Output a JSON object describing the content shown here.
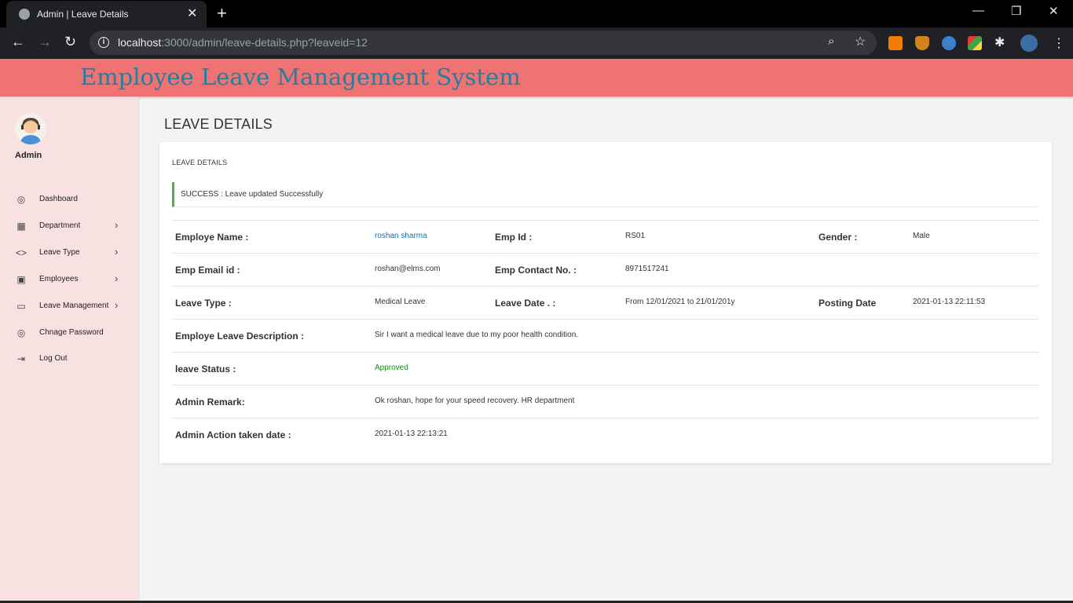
{
  "browser": {
    "tab_title": "Admin | Leave Details",
    "url_host": "localhost",
    "url_rest": ":3000/admin/leave-details.php?leaveid=12"
  },
  "app": {
    "brand": "Employee Leave Management System"
  },
  "sidebar": {
    "user": "Admin",
    "items": [
      {
        "label": "Dashboard",
        "icon": "palette-icon",
        "has_submenu": false
      },
      {
        "label": "Department",
        "icon": "grid-icon",
        "has_submenu": true
      },
      {
        "label": "Leave Type",
        "icon": "code-icon",
        "has_submenu": true
      },
      {
        "label": "Employees",
        "icon": "account-box-icon",
        "has_submenu": true
      },
      {
        "label": "Leave Management",
        "icon": "desktop-icon",
        "has_submenu": true
      },
      {
        "label": "Chnage Password",
        "icon": "palette-icon",
        "has_submenu": false
      },
      {
        "label": "Log Out",
        "icon": "logout-icon",
        "has_submenu": false
      }
    ]
  },
  "main": {
    "page_title": "LEAVE DETAILS",
    "card_title": "LEAVE DETAILS",
    "alert": "SUCCESS : Leave updated Successfully",
    "fields": {
      "emp_name_label": "Employe Name :",
      "emp_name": "roshan sharma",
      "emp_id_label": "Emp Id :",
      "emp_id": "RS01",
      "gender_label": "Gender :",
      "gender": "Male",
      "email_label": "Emp Email id :",
      "email": "roshan@elms.com",
      "contact_label": "Emp Contact No. :",
      "contact": "8971517241",
      "leave_type_label": "Leave Type :",
      "leave_type": "Medical Leave",
      "leave_date_label": "Leave Date . :",
      "leave_date": "From 12/01/2021 to 21/01/201y",
      "posting_date_label": "Posting Date",
      "posting_date": "2021-01-13 22:11:53",
      "description_label": "Employe Leave Description :",
      "description": "Sir I want a medical leave due to my poor health condition.",
      "status_label": "leave Status :",
      "status": "Approved",
      "remark_label": "Admin Remark:",
      "remark": "Ok roshan, hope for your speed recovery. HR department",
      "action_date_label": "Admin Action taken date :",
      "action_date": "2021-01-13 22:13:21"
    }
  },
  "colors": {
    "header_bg": "#ef7373",
    "brand_text": "#217fa0",
    "sidebar_bg": "#f7e1e1",
    "alert_accent": "#4caf50",
    "approved": "#138a13"
  }
}
